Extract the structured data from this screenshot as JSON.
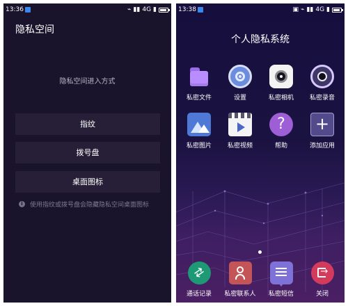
{
  "left_screen": {
    "status_bar": {
      "time": "13:36",
      "network": "4G"
    },
    "title": "隐私空间",
    "method_label": "隐私空间进入方式",
    "buttons": [
      {
        "label": "指纹"
      },
      {
        "label": "拨号盘"
      },
      {
        "label": "桌面图标"
      }
    ],
    "hint": "使用指纹或拨号盘会隐藏隐私空间桌面图标",
    "battery_level": 0.85
  },
  "right_screen": {
    "status_bar": {
      "time": "13:38",
      "network": "4G"
    },
    "title": "个人隐私系统",
    "apps": [
      {
        "label": "私密文件",
        "icon": "folder-icon"
      },
      {
        "label": "设置",
        "icon": "settings-icon"
      },
      {
        "label": "私密相机",
        "icon": "camera-icon"
      },
      {
        "label": "私密录音",
        "icon": "recorder-icon"
      },
      {
        "label": "私密图片",
        "icon": "photo-icon"
      },
      {
        "label": "私密视频",
        "icon": "video-icon"
      },
      {
        "label": "帮助",
        "icon": "help-icon"
      },
      {
        "label": "添加应用",
        "icon": "add-icon"
      }
    ],
    "dock": [
      {
        "label": "通话记录",
        "icon": "call-log-icon"
      },
      {
        "label": "私密联系人",
        "icon": "contacts-icon"
      },
      {
        "label": "私密短信",
        "icon": "sms-icon"
      },
      {
        "label": "关闭",
        "icon": "exit-icon"
      }
    ],
    "battery_level": 0.85
  }
}
